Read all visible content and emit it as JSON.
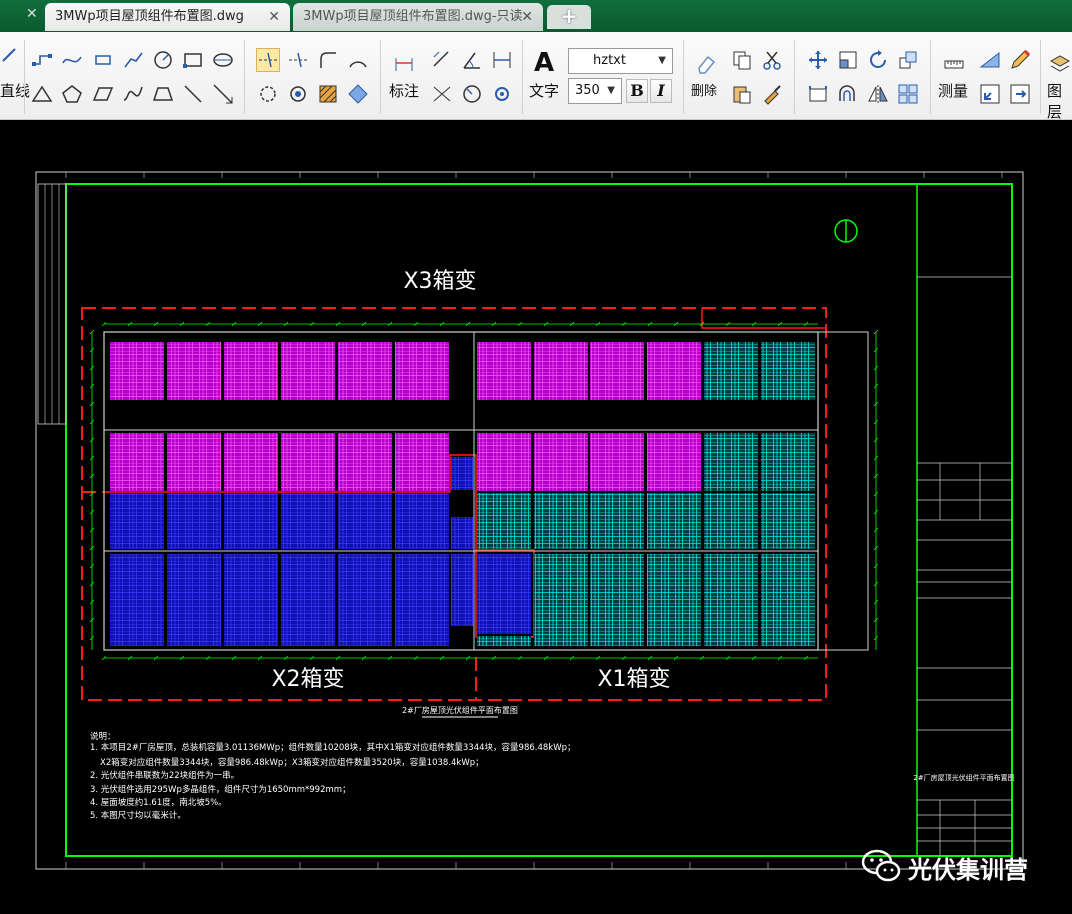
{
  "tabs": [
    {
      "label": "3MWp项目屋顶组件布置图.dwg",
      "active": true
    },
    {
      "label": "3MWp项目屋顶组件布置图.dwg-只读",
      "active": false
    }
  ],
  "toolbar": {
    "line_label": "直线",
    "dimension_label": "标注",
    "text_label": "文字",
    "text_style": "hztxt",
    "text_height": "350",
    "bold_label": "B",
    "italic_label": "I",
    "delete_label": "删除",
    "measure_label": "测量",
    "layer_label": "图层"
  },
  "drawing": {
    "top_transformer": "X3箱变",
    "bottom_left_transformer": "X2箱变",
    "bottom_right_transformer": "X1箱变",
    "plan_title": "2#厂房屋顶光伏组件平面布置图",
    "notes_title": "说明：",
    "notes": [
      "1. 本项目2#厂房屋顶，总装机容量3.01136MWp；组件数量10208块，其中X1箱变对应组件数量3344块，容量986.48kWp；",
      "X2箱变对应组件数量3344块，容量986.48kWp；X3箱变对应组件数量3520块，容量1038.4kWp；",
      "2. 光伏组件串联数为22块组件为一串。",
      "3. 光伏组件选用295Wp多晶组件，组件尺寸为1650mm*992mm；",
      "4. 屋面坡度约1.61度，南北坡5%。",
      "5. 本图尺寸均以毫米计。"
    ],
    "title_block_name": "2#厂房屋顶光伏组件平面布置图"
  },
  "watermark": {
    "text": "光伏集训营",
    "icon": "wechat-icon"
  },
  "colors": {
    "frame": "#00ff00",
    "magenta": "#e000e0",
    "blue": "#1a1ae6",
    "cyan": "#00e5e5",
    "red_dashed": "#ff1a1a"
  }
}
